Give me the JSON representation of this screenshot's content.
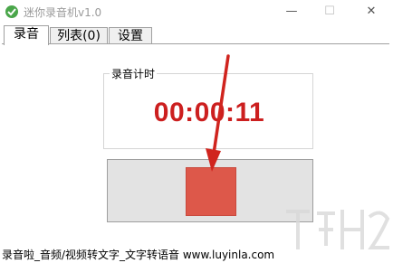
{
  "window": {
    "title": "迷你录音机v1.0",
    "minimize_glyph": "—",
    "maximize_glyph": "☐",
    "close_glyph": "✕"
  },
  "tabs": [
    {
      "label": "录音",
      "active": true
    },
    {
      "label": "列表(0)",
      "active": false
    },
    {
      "label": "设置",
      "active": false
    }
  ],
  "recording": {
    "group_label": "录音计时",
    "elapsed": "00:00:11",
    "timer_color": "#cc1f1f",
    "record_button_color": "#dd584a"
  },
  "annotation": {
    "arrow_color": "#d0241e"
  },
  "status_bar": {
    "text": "录音啦_音频/视频转文字_文字转语音 www.luyinla.com"
  },
  "watermark": {
    "description_icon": "watermark-logo-icon"
  }
}
